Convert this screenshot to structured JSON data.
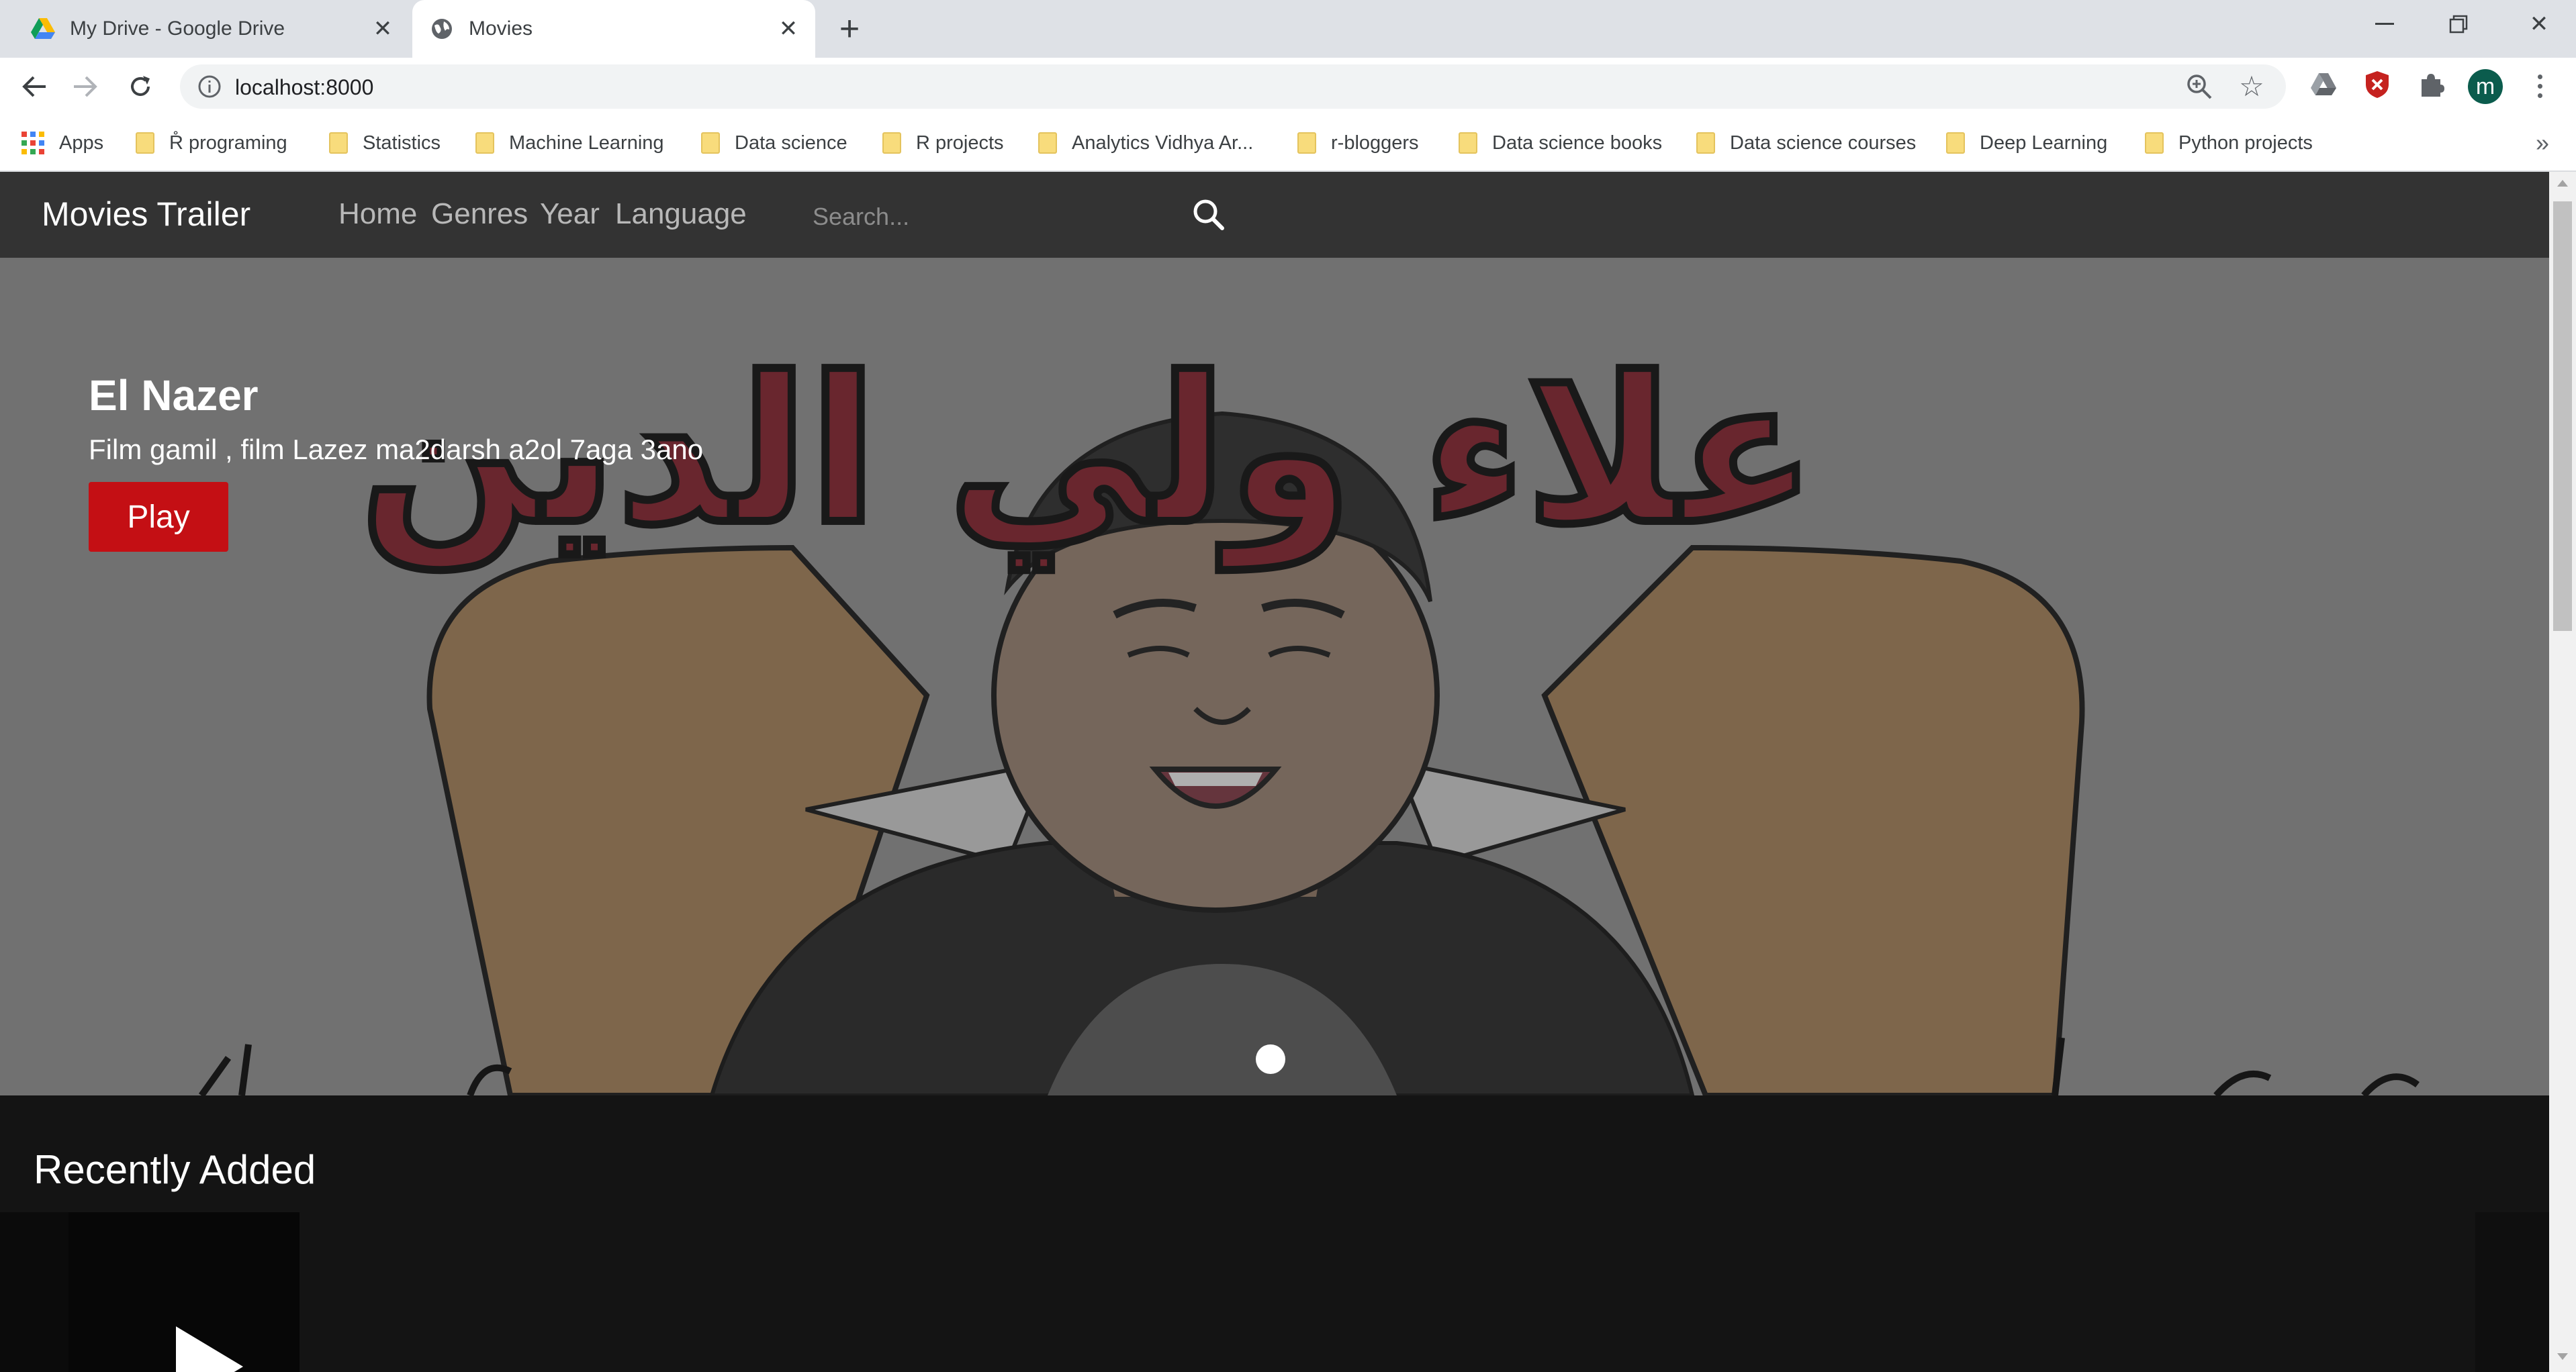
{
  "browser": {
    "tabs": [
      {
        "title": "My Drive - Google Drive",
        "icon": "google-drive-icon",
        "active": false
      },
      {
        "title": "Movies",
        "icon": "globe-icon",
        "active": true
      }
    ],
    "url": "localhost:8000",
    "profile_initial": "m",
    "bookmarks": [
      {
        "label": "Apps",
        "icon": "apps-grid-icon"
      },
      {
        "label": "R̊ programing"
      },
      {
        "label": "Statistics"
      },
      {
        "label": "Machine Learning"
      },
      {
        "label": "Data science"
      },
      {
        "label": "R projects"
      },
      {
        "label": "Analytics Vidhya Ar..."
      },
      {
        "label": "r-bloggers"
      },
      {
        "label": "Data science books"
      },
      {
        "label": "Data science courses"
      },
      {
        "label": "Deep Learning"
      },
      {
        "label": "Python projects"
      }
    ],
    "bookmarks_overflow": "»"
  },
  "site": {
    "brand": "Movies Trailer",
    "nav": [
      "Home",
      "Genres",
      "Year",
      "Language"
    ],
    "search_placeholder": "Search..."
  },
  "hero": {
    "title": "El Nazer",
    "subtitle": "Film gamil , film Lazez ma2darsh a2ol 7aga 3ano",
    "play_label": "Play",
    "poster_text": "علاء ولي الدين"
  },
  "sections": {
    "recently_added": "Recently Added"
  },
  "colors": {
    "accent_red": "#c40f14",
    "page_bg": "#141414",
    "nav_bg": "#262626"
  }
}
